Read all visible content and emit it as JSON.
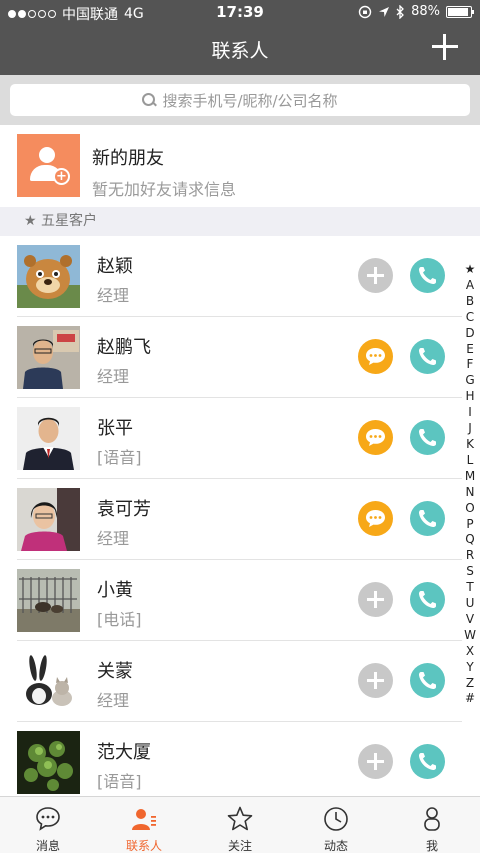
{
  "status": {
    "carrier": "中国联通",
    "network": "4G",
    "time": "17:39",
    "battery": "88%"
  },
  "nav": {
    "title": "联系人",
    "add_icon": "plus-icon"
  },
  "search": {
    "placeholder": "搜索手机号/昵称/公司名称"
  },
  "new_friend": {
    "title": "新的朋友",
    "subtitle": "暂无加好友请求信息"
  },
  "section": {
    "label": "★ 五星客户"
  },
  "contacts": [
    {
      "name": "赵颖",
      "role": "经理",
      "action": "add"
    },
    {
      "name": "赵鹏飞",
      "role": "经理",
      "action": "message"
    },
    {
      "name": "张平",
      "role": "[语音]",
      "action": "message"
    },
    {
      "name": "袁可芳",
      "role": "经理",
      "action": "message"
    },
    {
      "name": "小黄",
      "role": "[电话]",
      "action": "add"
    },
    {
      "name": "关蒙",
      "role": "经理",
      "action": "add"
    },
    {
      "name": "范大厦",
      "role": "[语音]",
      "action": "add"
    }
  ],
  "index_letters": [
    "★",
    "A",
    "B",
    "C",
    "D",
    "E",
    "F",
    "G",
    "H",
    "I",
    "J",
    "K",
    "L",
    "M",
    "N",
    "O",
    "P",
    "Q",
    "R",
    "S",
    "T",
    "U",
    "V",
    "W",
    "X",
    "Y",
    "Z",
    "#"
  ],
  "tabs": [
    {
      "label": "消息",
      "icon": "chat-bubble-icon",
      "active": false
    },
    {
      "label": "联系人",
      "icon": "contacts-icon",
      "active": true
    },
    {
      "label": "关注",
      "icon": "star-icon",
      "active": false
    },
    {
      "label": "动态",
      "icon": "clock-icon",
      "active": false
    },
    {
      "label": "我",
      "icon": "person-icon",
      "active": false
    }
  ],
  "colors": {
    "accent": "#f0662e",
    "call": "#5cc5c0",
    "message": "#f7a818",
    "add": "#c8c8c8",
    "topbar": "#545454"
  }
}
